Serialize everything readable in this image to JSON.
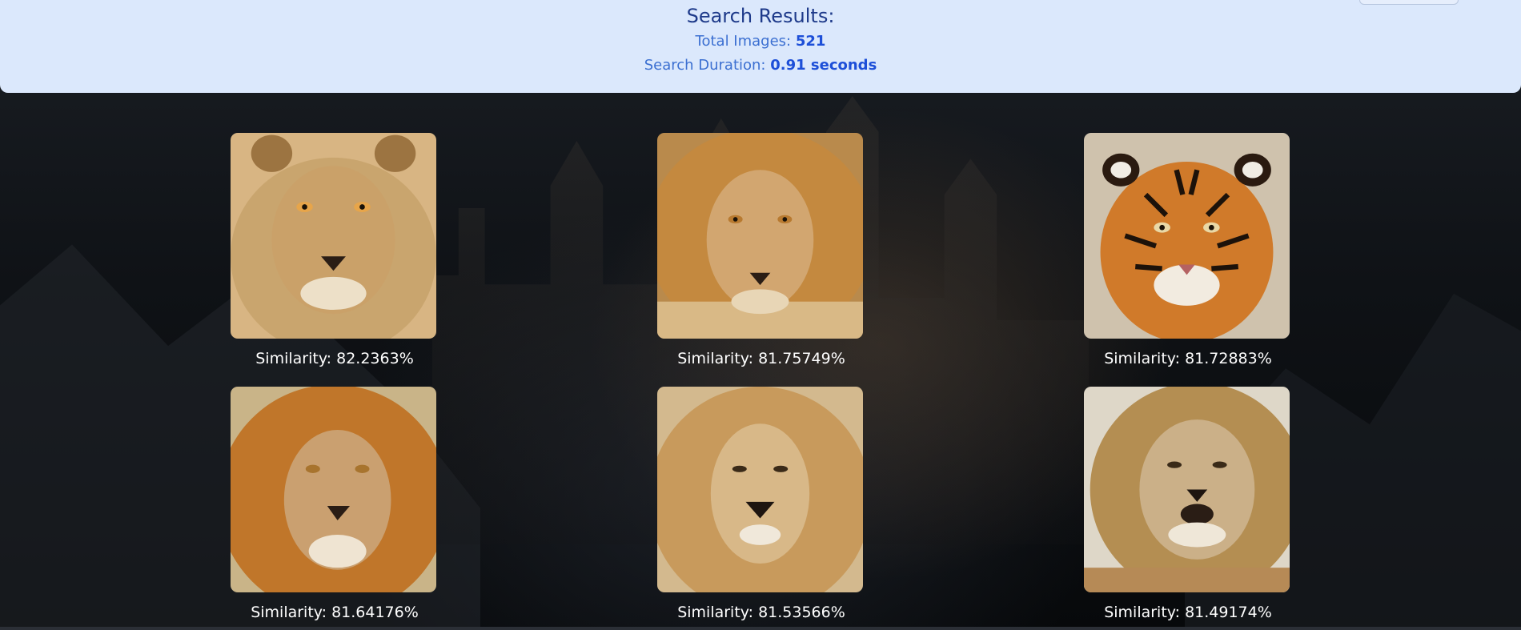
{
  "header": {
    "title": "Search Results:",
    "total_label": "Total Images:",
    "total_value": "521",
    "duration_label": "Search Duration:",
    "duration_value": "0.91 seconds"
  },
  "results": [
    {
      "similarity": "Similarity: 82.2363%",
      "subject": "lion"
    },
    {
      "similarity": "Similarity: 81.75749%",
      "subject": "lion"
    },
    {
      "similarity": "Similarity: 81.72883%",
      "subject": "tiger"
    },
    {
      "similarity": "Similarity: 81.64176%",
      "subject": "lion"
    },
    {
      "similarity": "Similarity: 81.53566%",
      "subject": "lion"
    },
    {
      "similarity": "Similarity: 81.49174%",
      "subject": "lion"
    }
  ]
}
